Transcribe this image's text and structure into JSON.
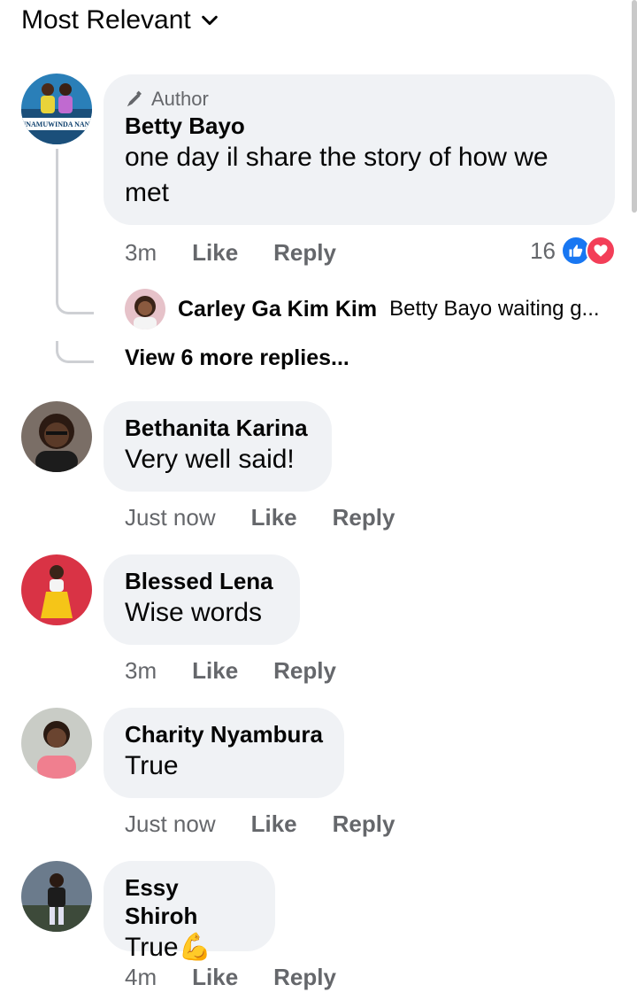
{
  "sort": {
    "label": "Most Relevant"
  },
  "comments": [
    {
      "badge": "Author",
      "name": "Betty Bayo",
      "text": "one day il share the story of how we met",
      "time": "3m",
      "like": "Like",
      "reply": "Reply",
      "reaction_count": "16",
      "avatar_caption": "UNAMUWINDA NANI",
      "replies": [
        {
          "name": "Carley Ga Kim Kim",
          "text": "Betty Bayo waiting g..."
        }
      ],
      "view_more": "View 6 more replies..."
    },
    {
      "name": "Bethanita Karina",
      "text": "Very well said!",
      "time": "Just now",
      "like": "Like",
      "reply": "Reply"
    },
    {
      "name": "Blessed Lena",
      "text": "Wise words",
      "time": "3m",
      "like": "Like",
      "reply": "Reply"
    },
    {
      "name": "Charity Nyambura",
      "text": "True",
      "time": "Just now",
      "like": "Like",
      "reply": "Reply"
    },
    {
      "name": "Essy Shiroh",
      "text": "True💪",
      "time": "4m",
      "like": "Like",
      "reply": "Reply"
    }
  ],
  "colors": {
    "bubble": "#f0f2f5",
    "meta": "#65676b",
    "like_blue": "#1877f2",
    "love_red": "#f33e58"
  }
}
